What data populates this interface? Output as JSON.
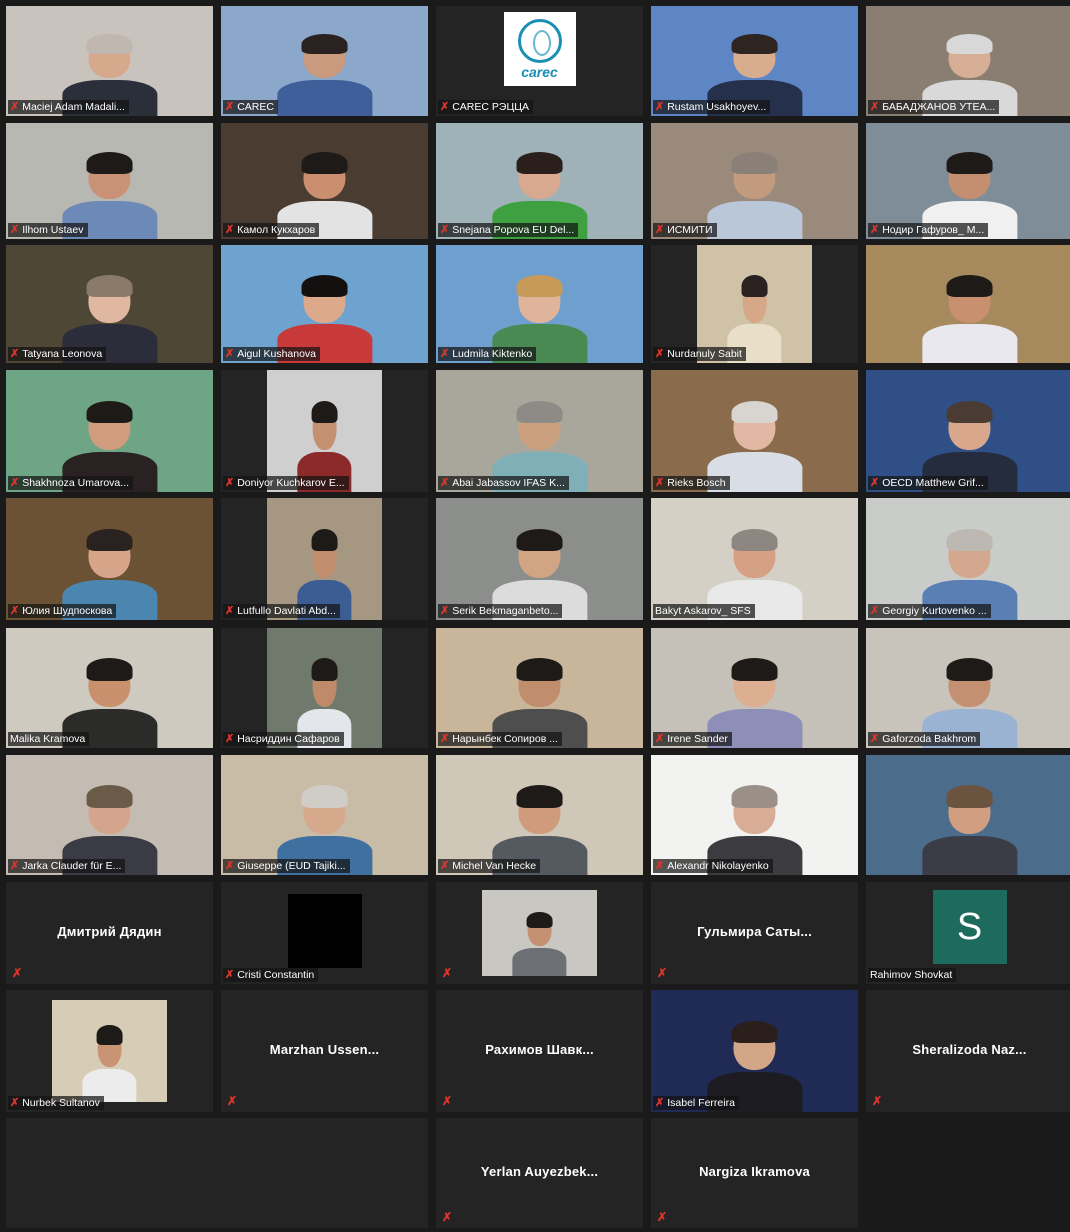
{
  "tiles": [
    {
      "name": "Maciej Adam Madali...",
      "mic": true,
      "kind": "video",
      "bg": "#c9c3bd",
      "skin": "#d6a88c",
      "shirt": "#2a2f3a",
      "hair": "#bfb7b0"
    },
    {
      "name": "CAREC",
      "mic": true,
      "kind": "video",
      "bg": "#8ba7c9",
      "skin": "#c99a7e",
      "shirt": "#3e5f9a",
      "hair": "#2a2220"
    },
    {
      "name": "CAREC РЭЦЦА",
      "mic": true,
      "kind": "logo",
      "logo_text": "carec"
    },
    {
      "name": "Rustam Usakhoyev...",
      "mic": true,
      "kind": "video",
      "bg": "#5f86c4",
      "skin": "#d8ac8e",
      "shirt": "#25304d",
      "hair": "#2e2420"
    },
    {
      "name": "БАБАДЖАНОВ УТЕА...",
      "mic": true,
      "kind": "video",
      "bg": "#8a7d72",
      "skin": "#d6ae95",
      "shirt": "#d9d9d9",
      "hair": "#d8d8d8"
    },
    {
      "name": "Ilhom Ustaev",
      "mic": true,
      "kind": "video",
      "bg": "#b8b8b2",
      "skin": "#c99276",
      "shirt": "#6d89b8",
      "hair": "#1e1a18"
    },
    {
      "name": "Камол Кукхаров",
      "mic": true,
      "kind": "video",
      "bg": "#4a3c30",
      "skin": "#c98f6e",
      "shirt": "#e3e3e3",
      "hair": "#1e1a18"
    },
    {
      "name": "Snejana Popova EU Del...",
      "mic": true,
      "kind": "video",
      "bg": "#9fb2b8",
      "skin": "#d9a98f",
      "shirt": "#3fa042",
      "hair": "#2a1f1a"
    },
    {
      "name": "ИСМИТИ",
      "mic": true,
      "kind": "video",
      "bg": "#9a8a7c",
      "skin": "#c29a7e",
      "shirt": "#b9c7d8",
      "hair": "#8a8078"
    },
    {
      "name": "Нодир Гафуров_ М...",
      "mic": true,
      "kind": "video",
      "bg": "#7f8d98",
      "skin": "#c48e70",
      "shirt": "#f0f0f0",
      "hair": "#1e1a18"
    },
    {
      "name": "Tatyana Leonova",
      "mic": true,
      "kind": "video",
      "bg": "#4f4736",
      "skin": "#e0b8a2",
      "shirt": "#2b2d3a",
      "hair": "#8a7a6a"
    },
    {
      "name": "Aigul Kushanova",
      "mic": true,
      "kind": "video",
      "bg": "#6ea2cf",
      "skin": "#dcaa8a",
      "shirt": "#c83a3a",
      "hair": "#141010"
    },
    {
      "name": "Ludmila Kiktenko",
      "mic": true,
      "kind": "video",
      "bg": "#6e9fcf",
      "skin": "#e0b49a",
      "shirt": "#4a8a52",
      "hair": "#c79a5a"
    },
    {
      "name": "Nurdanuly Sabit",
      "mic": true,
      "kind": "video",
      "bg": "#cfc2a6",
      "skin": "#d6a888",
      "shirt": "#e9dfc9",
      "hair": "#2a2220"
    },
    {
      "name": "",
      "mic": false,
      "kind": "video",
      "bg": "#a68a5e",
      "skin": "#c8906e",
      "shirt": "#e8e8ee",
      "hair": "#1e1a18"
    },
    {
      "name": "Shakhnoza Umarova...",
      "mic": true,
      "kind": "video",
      "bg": "#6ea584",
      "skin": "#d19b7e",
      "shirt": "#2a2222",
      "hair": "#1e1a18"
    },
    {
      "name": "Doniyor Kuchkarov E...",
      "mic": true,
      "kind": "video",
      "bg": "#cfcfcf",
      "skin": "#c49072",
      "shirt": "#8c2a2a",
      "hair": "#1e1a18"
    },
    {
      "name": "Abai Jabassov IFAS K...",
      "mic": true,
      "kind": "video",
      "bg": "#a9a79c",
      "skin": "#caa07e",
      "shirt": "#7fb0b8",
      "hair": "#8e8a86"
    },
    {
      "name": "Rieks Bosch",
      "mic": true,
      "kind": "video",
      "bg": "#8a6c4c",
      "skin": "#e2b7a4",
      "shirt": "#d9dde6",
      "hair": "#d8d4cf"
    },
    {
      "name": "OECD Matthew Grif...",
      "mic": true,
      "kind": "video",
      "bg": "#2f4f86",
      "skin": "#d9a88c",
      "shirt": "#252c3e",
      "hair": "#4a3c32"
    },
    {
      "name": "Юлия Шудпоскова",
      "mic": true,
      "kind": "video",
      "bg": "#6b5234",
      "skin": "#d6a488",
      "shirt": "#4b86b0",
      "hair": "#2a2220"
    },
    {
      "name": "Lutfullo Davlati Abd...",
      "mic": true,
      "kind": "video",
      "bg": "#a69782",
      "skin": "#c08d6d",
      "shirt": "#3c5d94",
      "hair": "#1e1a18"
    },
    {
      "name": "Serik Bekmaganbeto...",
      "mic": true,
      "kind": "video",
      "bg": "#8c8e8c",
      "skin": "#d1a484",
      "shirt": "#dcdcdc",
      "hair": "#1e1a18"
    },
    {
      "name": "Bakyt Askarov_ SFS",
      "mic": false,
      "kind": "video",
      "active": true,
      "bg": "#d4d0c6",
      "skin": "#d6a084",
      "shirt": "#e9e9e9",
      "hair": "#8e8680"
    },
    {
      "name": "Georgiy Kurtovenko ...",
      "mic": true,
      "kind": "video",
      "bg": "#c9ccc9",
      "skin": "#d4a88e",
      "shirt": "#5a7fb4",
      "hair": "#bdb8b2"
    },
    {
      "name": "Malika Kramova",
      "mic": false,
      "kind": "video",
      "bg": "#cfcac0",
      "skin": "#c9906e",
      "shirt": "#2b2c2a",
      "hair": "#1e1a18"
    },
    {
      "name": "Насриддин Сафаров",
      "mic": true,
      "kind": "video",
      "bg": "#6f7a6c",
      "skin": "#bf8a6a",
      "shirt": "#e3e6ea",
      "hair": "#1e1a18"
    },
    {
      "name": "Нарынбек Сопиров ...",
      "mic": true,
      "kind": "video",
      "bg": "#c9b59a",
      "skin": "#c08d6d",
      "shirt": "#4e4e4e",
      "hair": "#1e1a18"
    },
    {
      "name": "Irene Sander",
      "mic": true,
      "kind": "video",
      "bg": "#c5c0b8",
      "skin": "#dcae92",
      "shirt": "#8d8fb8",
      "hair": "#1e1a18"
    },
    {
      "name": "Gaforzoda Bakhrom",
      "mic": true,
      "kind": "video",
      "bg": "#c8c3bb",
      "skin": "#c49072",
      "shirt": "#9bb3d3",
      "hair": "#1e1a18"
    },
    {
      "name": "Jarka Clauder für E...",
      "mic": true,
      "kind": "video",
      "bg": "#c4bcb2",
      "skin": "#d4a48c",
      "shirt": "#3a3b45",
      "hair": "#6a5a48"
    },
    {
      "name": "Giuseppe (EUD Tajiki...",
      "mic": true,
      "kind": "video",
      "bg": "#c9bca6",
      "skin": "#d6a88c",
      "shirt": "#3f70a0",
      "hair": "#d0ccc6"
    },
    {
      "name": "Michel Van Hecke",
      "mic": true,
      "kind": "video",
      "bg": "#cfc7b8",
      "skin": "#cf9b7a",
      "shirt": "#555a60",
      "hair": "#1e1a18"
    },
    {
      "name": "Alexandr Nikolayenko",
      "mic": true,
      "kind": "video",
      "bg": "#f2f2f0",
      "skin": "#d9ac96",
      "shirt": "#3c3c40",
      "hair": "#9a9088"
    },
    {
      "name": "",
      "mic": false,
      "kind": "video",
      "bg": "#4b6c8a",
      "skin": "#d19e82",
      "shirt": "#3a3d45",
      "hair": "#6a5440"
    },
    {
      "name": "",
      "mic": true,
      "kind": "name",
      "display": "Дмитрий Дядин"
    },
    {
      "name": "Cristi Constantin",
      "mic": true,
      "kind": "black"
    },
    {
      "name": "",
      "mic": true,
      "kind": "video",
      "bg": "#c9c7c2",
      "skin": "#c49072",
      "shirt": "#6c7074",
      "hair": "#1e1a18"
    },
    {
      "name": "",
      "mic": true,
      "kind": "name",
      "display": "Гульмира  Саты..."
    },
    {
      "name": "Rahimov Shovkat",
      "mic": false,
      "kind": "avatar",
      "initial": "S"
    },
    {
      "name": "Nurbek Sultanov",
      "mic": true,
      "kind": "video",
      "bg": "#d7cdb6",
      "skin": "#c99474",
      "shirt": "#ececec",
      "hair": "#1e1a18"
    },
    {
      "name": "",
      "mic": true,
      "kind": "name",
      "display": "Marzhan  Ussen..."
    },
    {
      "name": "",
      "mic": true,
      "kind": "name",
      "display": "Рахимов  Шавк..."
    },
    {
      "name": "Isabel Ferreira",
      "mic": true,
      "kind": "video",
      "bg": "#1f2a55",
      "skin": "#d4a688",
      "shirt": "#1c1c22",
      "hair": "#2a1f1a"
    },
    {
      "name": "",
      "mic": true,
      "kind": "name",
      "display": "Sheralizoda  Naz..."
    },
    {
      "name": "",
      "mic": false,
      "kind": "empty"
    },
    {
      "name": "",
      "mic": true,
      "kind": "name",
      "display": "Yerlan  Auyezbek..."
    },
    {
      "name": "",
      "mic": true,
      "kind": "name",
      "display": "Nargiza  Ikramova"
    }
  ]
}
